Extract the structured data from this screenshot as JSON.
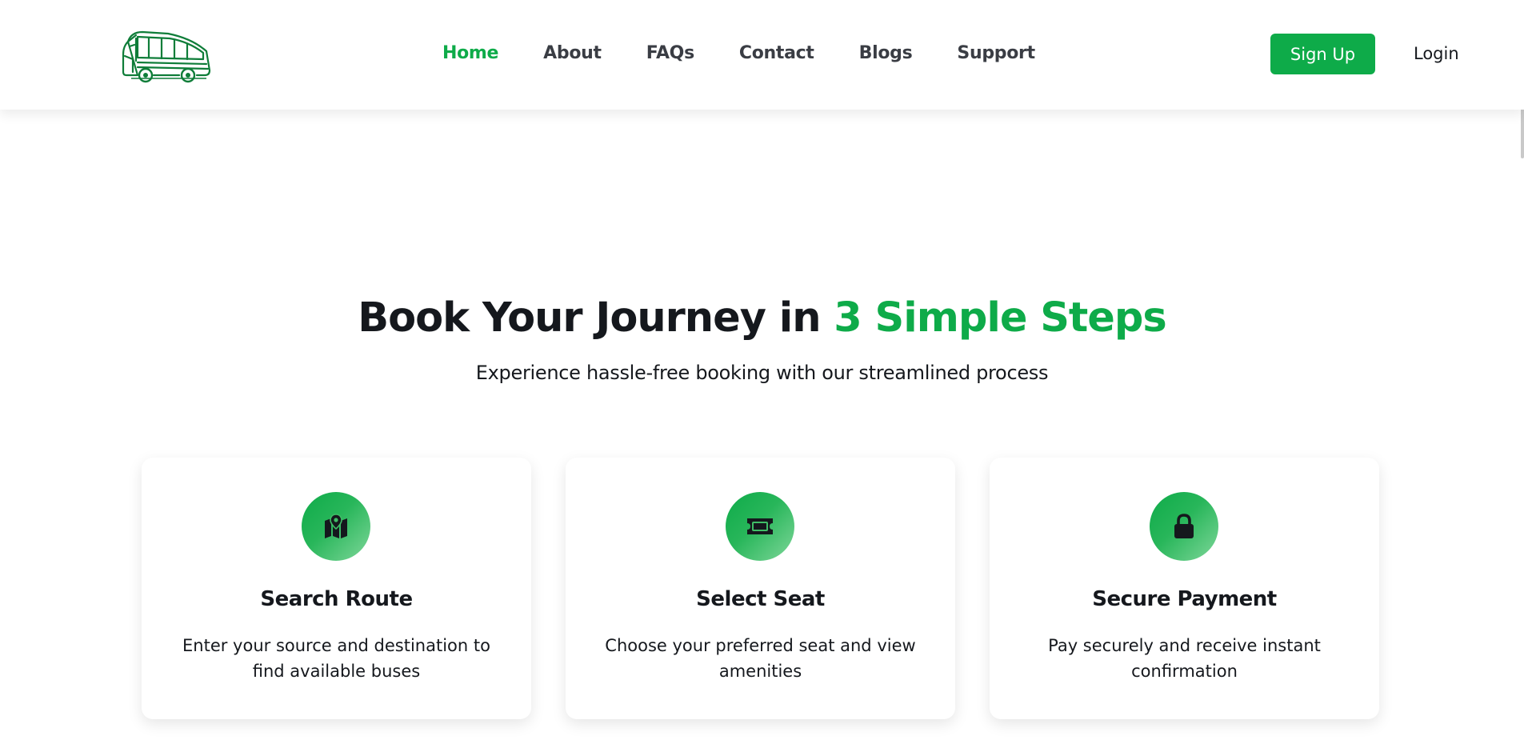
{
  "navbar": {
    "links": [
      {
        "label": "Home",
        "active": true
      },
      {
        "label": "About"
      },
      {
        "label": "FAQs"
      },
      {
        "label": "Contact"
      },
      {
        "label": "Blogs"
      },
      {
        "label": "Support"
      }
    ],
    "signup_label": "Sign Up",
    "login_label": "Login"
  },
  "hero": {
    "title_main": "Book Your Journey in ",
    "title_accent": "3 Simple Steps",
    "subtitle": "Experience hassle-free booking with our streamlined process"
  },
  "steps": [
    {
      "icon": "map-location-icon",
      "title": "Search Route",
      "text": "Enter your source and destination to find available buses"
    },
    {
      "icon": "ticket-icon",
      "title": "Select Seat",
      "text": "Choose your preferred seat and view amenities"
    },
    {
      "icon": "lock-icon",
      "title": "Secure Payment",
      "text": "Pay securely and receive instant confirmation"
    }
  ],
  "colors": {
    "accent": "#0eab49",
    "text": "#15181d",
    "nav_text": "#3a3d44"
  }
}
